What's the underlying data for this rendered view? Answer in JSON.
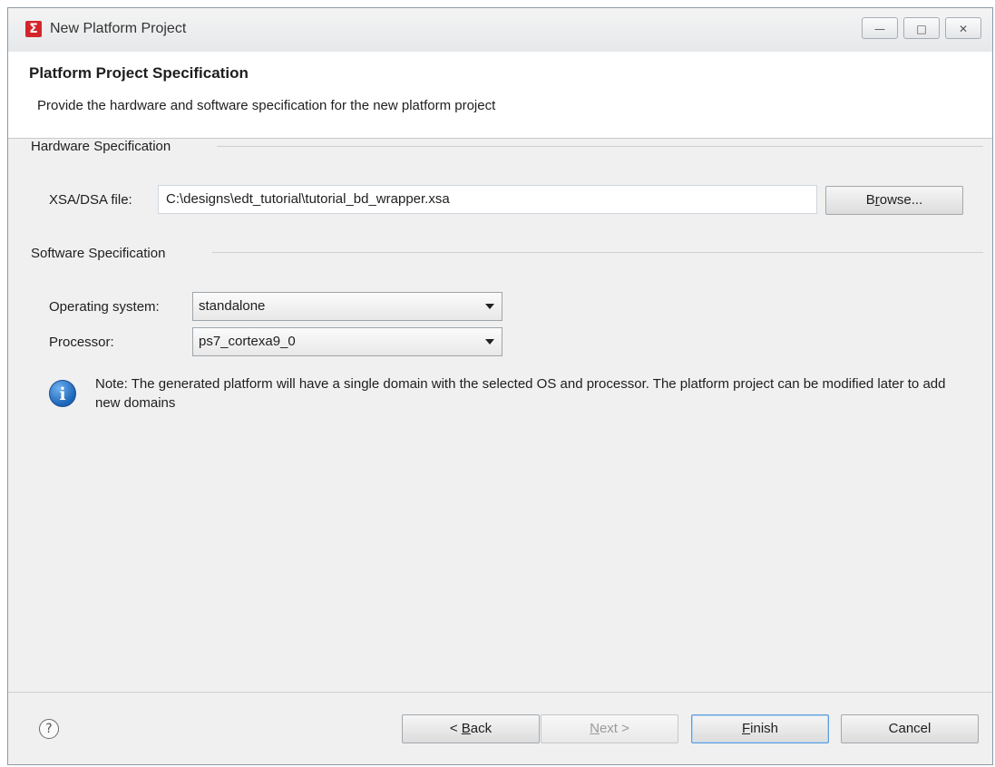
{
  "window": {
    "title": "New Platform Project",
    "app_icon_glyph": "Σ",
    "controls": {
      "minimize_glyph": "—",
      "maximize_glyph": "□",
      "close_glyph": "✕"
    }
  },
  "header": {
    "title": "Platform Project Specification",
    "description": "Provide the hardware and software specification for the new platform project"
  },
  "hardware": {
    "group_label": "Hardware Specification",
    "file_label": "XSA/DSA file:",
    "file_value": "C:\\designs\\edt_tutorial\\tutorial_bd_wrapper.xsa",
    "browse_label": "Browse..."
  },
  "software": {
    "group_label": "Software Specification",
    "os_label": "Operating system:",
    "os_value": "standalone",
    "processor_label": "Processor:",
    "processor_value": "ps7_cortexa9_0"
  },
  "note": {
    "text": "Note: The generated platform will have a single domain with the selected OS and processor. The platform project can be modified later to add new domains"
  },
  "footer": {
    "help_glyph": "?",
    "back_label": "< Back",
    "next_label": "Next >",
    "finish_label": "Finish",
    "cancel_label": "Cancel"
  },
  "icons": {
    "app": "xilinx-sigma-icon",
    "info": "info-icon",
    "help": "help-icon",
    "dropdown": "chevron-down-icon"
  }
}
